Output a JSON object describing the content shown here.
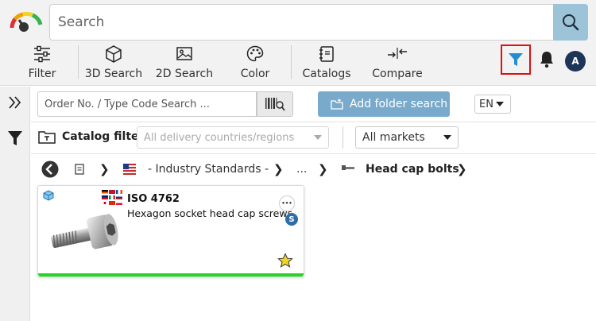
{
  "search": {
    "placeholder": "Search"
  },
  "toolbar": {
    "filter_label": "Filter",
    "search3d_label": "3D Search",
    "search2d_label": "2D Search",
    "color_label": "Color",
    "catalogs_label": "Catalogs",
    "compare_label": "Compare"
  },
  "user": {
    "avatar_initial": "A"
  },
  "order_search": {
    "placeholder": "Order No. / Type Code Search ..."
  },
  "add_folder_label": "Add folder search",
  "language": {
    "selected": "EN"
  },
  "catalog_filter": {
    "label": "Catalog filter",
    "countries_placeholder": "All delivery countries/regions",
    "markets_selected": "All markets"
  },
  "breadcrumb": {
    "items": [
      "- Industry Standards -",
      "...",
      "Head cap bolts"
    ]
  },
  "results": [
    {
      "title": "ISO 4762",
      "subtitle": "Hexagon socket head cap screws",
      "badge": "S",
      "more": "•••"
    }
  ],
  "colors": {
    "accent": "#79aacb",
    "search_button": "#9dc3d8",
    "highlight_border": "#e01010",
    "filter_icon": "#1f8fd6",
    "status_bar": "#22d622",
    "star": "#f3d22a"
  }
}
